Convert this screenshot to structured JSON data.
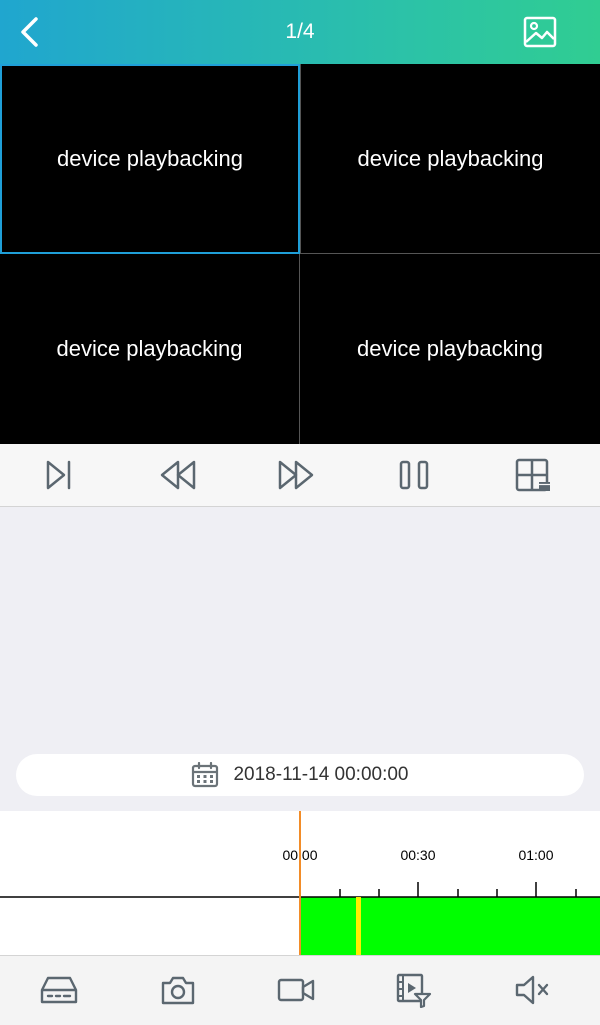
{
  "header": {
    "title": "1/4",
    "back_icon": "chevron-left-icon",
    "gallery_icon": "image-gallery-icon",
    "background_start": "#20a6cf",
    "background_end": "#30cd92"
  },
  "video_grid": {
    "selected_index": 0,
    "selected_border_color": "#1f9fd8",
    "cells": [
      {
        "status": "device playbacking"
      },
      {
        "status": "device playbacking"
      },
      {
        "status": "device playbacking"
      },
      {
        "status": "device playbacking"
      }
    ]
  },
  "controls": [
    {
      "name": "play-next-frame-button",
      "icon": "skip-frame-icon"
    },
    {
      "name": "rewind-button",
      "icon": "rewind-icon"
    },
    {
      "name": "fast-forward-button",
      "icon": "fast-forward-icon"
    },
    {
      "name": "pause-button",
      "icon": "pause-icon"
    },
    {
      "name": "layout-switch-button",
      "icon": "grid-layout-icon"
    }
  ],
  "date_picker": {
    "icon": "calendar-icon",
    "value": "2018-11-14 00:00:00"
  },
  "timeline": {
    "labels": [
      "00:00",
      "00:30",
      "01:00"
    ],
    "recording_color": "#00ff00",
    "cursor_color": "#f28c28",
    "marker_color": "#ffee00"
  },
  "toolbar": [
    {
      "name": "device-button",
      "icon": "dvr-icon"
    },
    {
      "name": "snapshot-button",
      "icon": "camera-icon"
    },
    {
      "name": "record-button",
      "icon": "video-camera-icon"
    },
    {
      "name": "video-filter-button",
      "icon": "video-filter-icon"
    },
    {
      "name": "mute-button",
      "icon": "speaker-muted-icon"
    }
  ]
}
